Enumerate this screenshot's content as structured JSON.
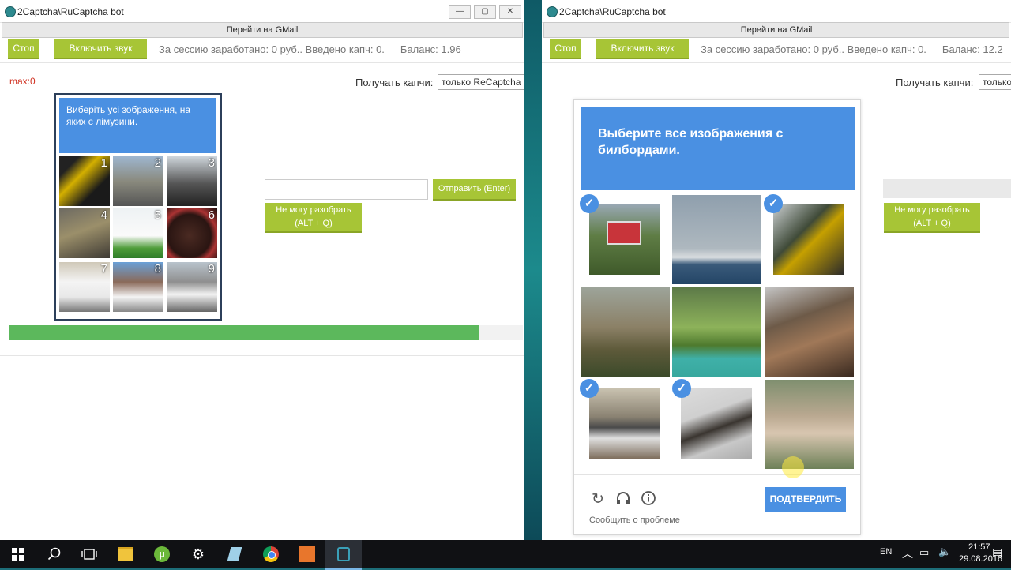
{
  "left_window": {
    "title": "2Captcha\\RuCaptcha bot",
    "gmail_link": "Перейти на GMail",
    "stop_label": "Стоп",
    "sound_label": "Включить звук",
    "session_stats": "За сессию заработано: 0 руб.. Введено капч: 0.",
    "balance": "Баланс: 1.96",
    "max_label": "max:0",
    "receive_label": "Получать капчи:",
    "receive_value": "только ReCaptcha",
    "captcha_instruction": "Виберіть усі зображення, на яких є лімузини.",
    "tile_numbers": [
      "1",
      "2",
      "3",
      "4",
      "5",
      "6",
      "7",
      "8",
      "9"
    ],
    "send_label": "Отправить (Enter)",
    "cant_solve_label": "Не могу разобрать (ALT + Q)",
    "progress": 0.915,
    "progress_color": "#5cb85c",
    "accent_color": "#a7c536"
  },
  "right_window": {
    "title": "2Captcha\\RuCaptcha bot",
    "gmail_link": "Перейти на GMail",
    "stop_label": "Стоп",
    "sound_label": "Включить звук",
    "session_stats": "За сессию заработано: 0 руб.. Введено капч: 0.",
    "balance": "Баланс: 12.2",
    "receive_label": "Получать капчи:",
    "receive_value": "только",
    "cant_solve_label": "Не могу разобрать (ALT + Q)"
  },
  "recaptcha": {
    "instruction": "Выберите все изображения с билбордами.",
    "selected_tiles": [
      1,
      3,
      7,
      8
    ],
    "reload_icon": "reload-icon",
    "audio_icon": "headphones-icon",
    "info_icon": "info-icon",
    "report_label": "Сообщить о проблеме",
    "verify_label": "ПОДТВЕРДИТЬ",
    "accent_color": "#4a90e2"
  },
  "taskbar": {
    "icons": [
      "windows-start-icon",
      "search-icon",
      "task-view-icon",
      "file-explorer-icon",
      "utorrent-icon",
      "settings-icon",
      "notepad-icon",
      "chrome-icon",
      "app-icon",
      "unlock-icon"
    ],
    "lang": "EN",
    "time": "21:57",
    "date": "29.08.2016"
  }
}
